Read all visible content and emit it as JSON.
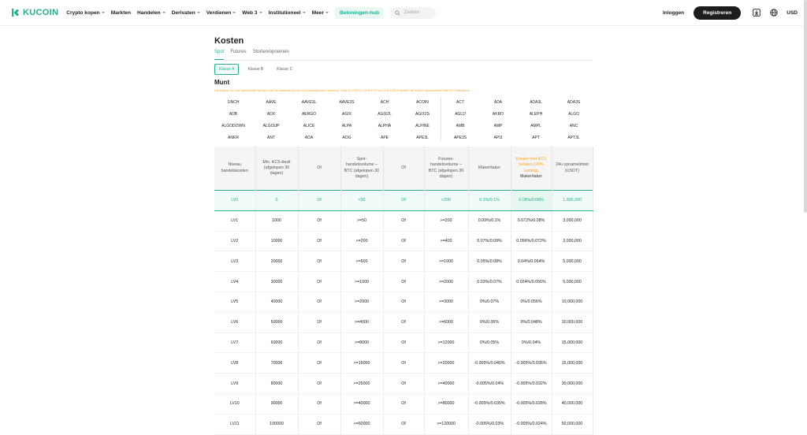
{
  "header": {
    "logo": "KUCOIN",
    "nav": [
      {
        "label": "Crypto kopen",
        "dropdown": true
      },
      {
        "label": "Markten",
        "dropdown": false
      },
      {
        "label": "Handelen",
        "dropdown": true
      },
      {
        "label": "Derivaten",
        "dropdown": true
      },
      {
        "label": "Verdienen",
        "dropdown": true
      },
      {
        "label": "Web 3",
        "dropdown": true
      },
      {
        "label": "Institutioneel",
        "dropdown": true
      },
      {
        "label": "Meer",
        "dropdown": true
      }
    ],
    "rewards": "Beloningen-hub",
    "search_placeholder": "Zoeken",
    "login": "Inloggen",
    "register": "Registreren",
    "currency": "USD",
    "icons": [
      "download-icon",
      "globe-icon",
      "search-icon"
    ]
  },
  "page": {
    "title": "Kosten",
    "tabs": [
      "Spot",
      "Futures",
      "Storten/opnemen"
    ],
    "active_tab": "Spot",
    "classes": [
      "Klasse A",
      "Klasse B",
      "Klasse C"
    ],
    "active_class": "Klasse A",
    "coin_heading": "Munt",
    "note": "De kosten voor de spothandel worden met de basisvaluta van een handelspaar berekend. Voor KCS/BTC, KCS/ETH en KCS/USDT worden de kosten bijvoorbeeld met KCS berekend."
  },
  "coins": [
    "1INCH",
    "AAVE",
    "AAVE3L",
    "AAVE3S",
    "ACH",
    "ACOIN",
    "ACT",
    "ADA",
    "ADA3L",
    "ADA3S",
    "ADB",
    "ADX",
    "AERGO",
    "AGIX",
    "AGIX2L",
    "AGIX2S",
    "AGLD",
    "AKRO",
    "ALEPH",
    "ALGO",
    "ALGODOWN",
    "ALGOUP",
    "ALICE",
    "ALPA",
    "ALPHA",
    "ALPINE",
    "AMB",
    "AMP",
    "AMPL",
    "ANC",
    "ANKR",
    "ANT",
    "AOA",
    "AOG",
    "APE",
    "APE3L",
    "APE3S",
    "API3",
    "APT",
    "APT3L"
  ],
  "table": {
    "headers": [
      "Niveau handelskosten",
      "Min. KCS-bezit (afgelopen 30 dagen)",
      "Of",
      "Spot-handelsvolume – BTC (afgelopen 30 dagen)",
      "Of",
      "Futures-handelsvolume – BTC (afgelopen 30 dagen)",
      "Maker/taker",
      "Kosten met KCS betalen (20% korting)",
      "24u opnamelimiet (USDT)"
    ],
    "kcs_sub": "Maker/taker",
    "rows": [
      [
        "LV0",
        "0",
        "Of",
        "<50",
        "Of",
        "<200",
        "0.1%/0.1%",
        "0.08%/0.08%",
        "1,000,000"
      ],
      [
        "LV1",
        "1000",
        "Of",
        ">=50",
        "Of",
        ">=200",
        "0.09%/0.1%",
        "0.072%/0.08%",
        "3,000,000"
      ],
      [
        "LV2",
        "10000",
        "Of",
        ">=200",
        "Of",
        ">=400",
        "0.07%/0.09%",
        "0.056%/0.072%",
        "3,000,000"
      ],
      [
        "LV3",
        "20000",
        "Of",
        ">=500",
        "Of",
        ">=1000",
        "0.05%/0.08%",
        "0.04%/0.064%",
        "5,000,000"
      ],
      [
        "LV4",
        "30000",
        "Of",
        ">=1000",
        "Of",
        ">=2000",
        "0.03%/0.07%",
        "0.024%/0.056%",
        "5,000,000"
      ],
      [
        "LV5",
        "40000",
        "Of",
        ">=2000",
        "Of",
        ">=3000",
        "0%/0.07%",
        "0%/0.056%",
        "10,000,000"
      ],
      [
        "LV6",
        "50000",
        "Of",
        ">=4000",
        "Of",
        ">=6000",
        "0%/0.06%",
        "0%/0.048%",
        "10,000,000"
      ],
      [
        "LV7",
        "60000",
        "Of",
        ">=8000",
        "Of",
        ">=12000",
        "0%/0.05%",
        "0%/0.04%",
        "15,000,000"
      ],
      [
        "LV8",
        "70000",
        "Of",
        ">=15000",
        "Of",
        ">=20000",
        "-0.005%/0.045%",
        "-0.005%/0.036%",
        "15,000,000"
      ],
      [
        "LV9",
        "80000",
        "Of",
        ">=25000",
        "Of",
        ">=40000",
        "-0.005%/0.04%",
        "-0.005%/0.032%",
        "30,000,000"
      ],
      [
        "LV10",
        "90000",
        "Of",
        ">=40000",
        "Of",
        ">=80000",
        "-0.005%/0.035%",
        "-0.005%/0.028%",
        "40,000,000"
      ],
      [
        "LV11",
        "100000",
        "Of",
        ">=60000",
        "Of",
        ">=120000",
        "-0.005%/0.03%",
        "-0.005%/0.024%",
        "50,000,000"
      ]
    ]
  },
  "colors": {
    "accent": "#24ae8f",
    "highlight": "#f5a623",
    "dark": "#1d1d1d"
  }
}
